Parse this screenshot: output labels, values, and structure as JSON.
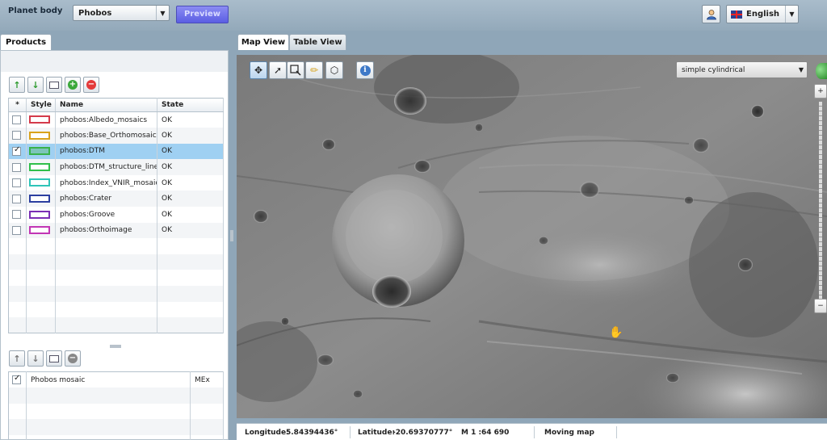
{
  "header": {
    "planet_label": "Planet body",
    "planet_value": "Phobos",
    "preview_label": "Preview",
    "language_value": "English"
  },
  "left": {
    "tab_products": "Products",
    "layers_table": {
      "headers": [
        "*",
        "Style",
        "Name",
        "State"
      ],
      "rows": [
        {
          "checked": false,
          "color": "#d43a4a",
          "name": "phobos:Albedo_mosaics",
          "state": "OK"
        },
        {
          "checked": false,
          "color": "#d9a21c",
          "name": "phobos:Base_Orthomosaics",
          "state": "OK"
        },
        {
          "checked": true,
          "color": "#38b24a",
          "name": "phobos:DTM",
          "state": "OK"
        },
        {
          "checked": false,
          "color": "#2fbf4a",
          "name": "phobos:DTM_structure_lines",
          "state": "OK"
        },
        {
          "checked": false,
          "color": "#2fc4b8",
          "name": "phobos:Index_VNIR_mosaics",
          "state": "OK"
        },
        {
          "checked": false,
          "color": "#2c3fa0",
          "name": "phobos:Crater",
          "state": "OK"
        },
        {
          "checked": false,
          "color": "#7a2fb5",
          "name": "phobos:Groove",
          "state": "OK"
        },
        {
          "checked": false,
          "color": "#c235b5",
          "name": "phobos:Orthoimage",
          "state": "OK"
        }
      ]
    },
    "basemap_table": {
      "rows": [
        {
          "checked": true,
          "name": "Phobos mosaic",
          "source": "MEx"
        }
      ]
    }
  },
  "map": {
    "tab_map_view": "Map View",
    "tab_table_view": "Table View",
    "projection_value": "simple cylindrical",
    "status": {
      "longitude_label": "Longitude:",
      "longitude_value": "5.84394436°",
      "latitude_label": "Latitude:",
      "latitude_value": "-20.69370777°",
      "scale_label": "M 1 :",
      "scale_value": "64 690",
      "mode_text": "Moving map"
    }
  },
  "colors": {
    "selected_row": "#9fd0f2",
    "preview_button": "#6b6de8"
  },
  "icons": [
    "user-icon",
    "uk-flag-icon",
    "move-up-icon",
    "move-down-icon",
    "comment-icon",
    "add-icon",
    "remove-icon",
    "pan-icon",
    "select-arrow-icon",
    "zoom-box-icon",
    "pencil-icon",
    "polygon-icon",
    "info-icon",
    "hand-cursor-icon"
  ]
}
